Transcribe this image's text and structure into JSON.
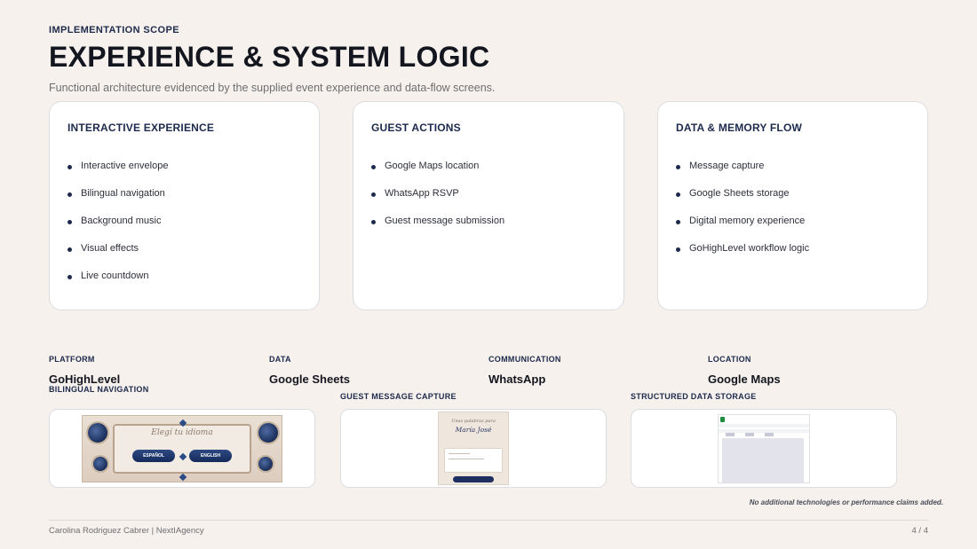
{
  "header": {
    "eyebrow": "IMPLEMENTATION SCOPE",
    "title": "EXPERIENCE & SYSTEM LOGIC",
    "subtitle": "Functional architecture evidenced by the supplied event experience and data-flow screens."
  },
  "cards": [
    {
      "title": "INTERACTIVE EXPERIENCE",
      "items": [
        "Interactive envelope",
        "Bilingual navigation",
        "Background music",
        "Visual effects",
        "Live countdown"
      ]
    },
    {
      "title": "GUEST ACTIONS",
      "items": [
        "Google Maps location",
        "WhatsApp RSVP",
        "Guest message submission"
      ]
    },
    {
      "title": "DATA & MEMORY FLOW",
      "items": [
        "Message capture",
        "Google Sheets storage",
        "Digital memory experience",
        "GoHighLevel workflow logic"
      ]
    }
  ],
  "tech": [
    {
      "label": "PLATFORM",
      "value": "GoHighLevel"
    },
    {
      "label": "DATA",
      "value": "Google Sheets"
    },
    {
      "label": "COMMUNICATION",
      "value": "WhatsApp"
    },
    {
      "label": "LOCATION",
      "value": "Google Maps"
    }
  ],
  "screenshots": [
    {
      "label": "BILINGUAL NAVIGATION",
      "heading": "Elegí tu idioma",
      "buttons": [
        "ESPAÑOL",
        "ENGLISH"
      ]
    },
    {
      "label": "GUEST MESSAGE CAPTURE",
      "line1": "Unas palabras para",
      "line2": "María José"
    },
    {
      "label": "STRUCTURED DATA STORAGE"
    }
  ],
  "note": "No additional technologies or performance claims added.",
  "footer": {
    "author": "Carolina Rodriguez Cabrer | NextIAgency",
    "page": "4 / 4"
  },
  "colors": {
    "background": "#f6f1ec",
    "navy": "#1d2a4d",
    "card": "#ffffff"
  }
}
